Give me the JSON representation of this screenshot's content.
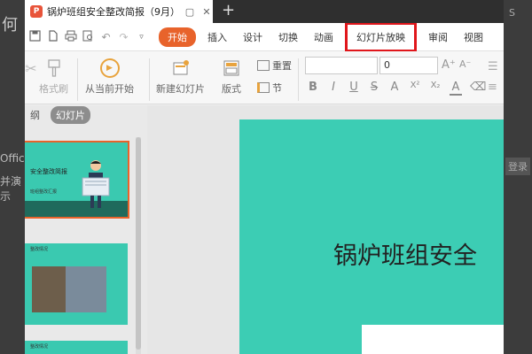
{
  "document_title": "锅炉班组安全整改简报（9月）",
  "tab_buttons": {
    "pin": "▢",
    "close": "✕",
    "new_tab": "+"
  },
  "quick_access_icons": [
    "save-icon",
    "print-icon",
    "undo-icon",
    "redo-icon"
  ],
  "menu": {
    "items": [
      "开始",
      "插入",
      "设计",
      "切换",
      "动画",
      "幻灯片放映",
      "审阅",
      "视图"
    ],
    "active": "开始",
    "highlighted": "幻灯片放映"
  },
  "ribbon": {
    "paste_format": "格式刷",
    "from_current": "从当前开始",
    "new_slide": "新建幻灯片",
    "layout": "版式",
    "reset": "重置",
    "section": "节",
    "font_size": "0",
    "format_buttons": [
      "B",
      "I",
      "U",
      "S",
      "A",
      "X²",
      "X₂",
      "A"
    ]
  },
  "left_panel": {
    "tabs": [
      "纲",
      "幻灯片"
    ],
    "selected_tab": "幻灯片",
    "thumb1_title": "安全整改简报",
    "thumb1_sub": "班组整改汇报",
    "thumb2_label": "整改情况",
    "thumb3_label": "整改情况"
  },
  "slide": {
    "title": "锅炉班组安全"
  },
  "background": {
    "left_fragments": [
      "何",
      "Offic",
      "并演示"
    ],
    "right_fragments": [
      "S",
      "登录"
    ]
  },
  "colors": {
    "accent": "#e8632b",
    "highlight_box": "#e0161b",
    "slide_bg": "#3ccdb4"
  }
}
